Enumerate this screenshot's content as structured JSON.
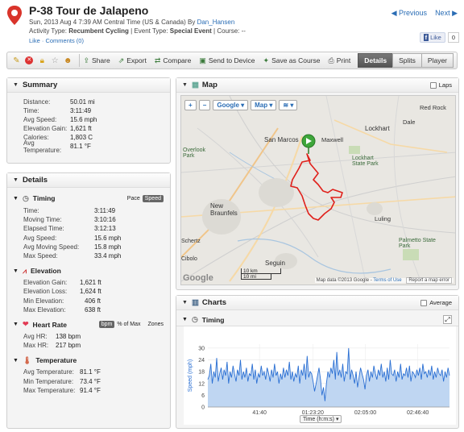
{
  "header": {
    "title": "P-38 Tour de Jalapeno",
    "date_line": "Sun, 2013 Aug 4 7:39 AM Central Time (US & Canada) By",
    "author": "Dan_Hansen",
    "activity_type_label": "Activity Type:",
    "activity_type": "Recumbent Cycling",
    "event_type_label": "| Event Type:",
    "event_type": "Special Event",
    "course_label": "| Course: --",
    "like_link": "Like",
    "comments_link": "· Comments (0)",
    "previous": "◀ Previous",
    "next": "Next ▶",
    "fb_like": "Like",
    "fb_count": "0"
  },
  "toolbar": {
    "share": "Share",
    "export": "Export",
    "compare": "Compare",
    "send": "Send to Device",
    "save_course": "Save as Course",
    "print": "Print",
    "tabs": [
      "Details",
      "Splits",
      "Player"
    ]
  },
  "summary": {
    "title": "Summary",
    "rows": [
      {
        "k": "Distance:",
        "v": "50.01 mi"
      },
      {
        "k": "Time:",
        "v": "3:11:49"
      },
      {
        "k": "Avg Speed:",
        "v": "15.6 mph"
      },
      {
        "k": "Elevation Gain:",
        "v": "1,621 ft"
      },
      {
        "k": "Calories:",
        "v": "1,803 C"
      },
      {
        "k": "Avg Temperature:",
        "v": "81.1 °F"
      }
    ]
  },
  "details": {
    "title": "Details",
    "timing": {
      "title": "Timing",
      "pace": "Pace",
      "speed": "Speed",
      "rows": [
        {
          "k": "Time:",
          "v": "3:11:49"
        },
        {
          "k": "Moving Time:",
          "v": "3:10:16"
        },
        {
          "k": "Elapsed Time:",
          "v": "3:12:13"
        },
        {
          "k": "Avg Speed:",
          "v": "15.6 mph"
        },
        {
          "k": "Avg Moving Speed:",
          "v": "15.8 mph"
        },
        {
          "k": "Max Speed:",
          "v": "33.4 mph"
        }
      ]
    },
    "elevation": {
      "title": "Elevation",
      "rows": [
        {
          "k": "Elevation Gain:",
          "v": "1,621 ft"
        },
        {
          "k": "Elevation Loss:",
          "v": "1,624 ft"
        },
        {
          "k": "Min Elevation:",
          "v": "406 ft"
        },
        {
          "k": "Max Elevation:",
          "v": "638 ft"
        }
      ]
    },
    "heart_rate": {
      "title": "Heart Rate",
      "bpm": "bpm",
      "pct_max": "% of Max",
      "zones": "Zones",
      "rows": [
        {
          "k": "Avg HR:",
          "v": "138 bpm"
        },
        {
          "k": "Max HR:",
          "v": "217 bpm"
        }
      ]
    },
    "temperature": {
      "title": "Temperature",
      "rows": [
        {
          "k": "Avg Temperature:",
          "v": "81.1 °F"
        },
        {
          "k": "Min Temperature:",
          "v": "73.4 °F"
        },
        {
          "k": "Max Temperature:",
          "v": "91.4 °F"
        }
      ]
    }
  },
  "map": {
    "title": "Map",
    "laps": "Laps",
    "zoom_in": "+",
    "zoom_out": "−",
    "provider": "Google ▾",
    "maptype": "Map ▾",
    "layers": "≋ ▾",
    "places": [
      "San Marcos",
      "Maxwell",
      "Lockhart",
      "Red Rock",
      "Dale",
      "Overlook Park",
      "Lockhart State Park",
      "New Braunfels",
      "Luling",
      "Seguin",
      "Palmetto State Park",
      "Schertz",
      "Cibolo"
    ],
    "scale_km": "10 km",
    "scale_mi": "10 mi",
    "google": "Google",
    "attribution": "Map data ©2013 Google -",
    "terms": "Terms of Use",
    "report": "Report a map error"
  },
  "charts": {
    "title": "Charts",
    "average": "Average",
    "timing_title": "Timing",
    "expand_icon": "expand-icon",
    "axis_select": "Time (h:m:s) ▾"
  },
  "chart_data": {
    "type": "area",
    "xlabel": "Time (h:m:s)",
    "ylabel": "Speed (mph)",
    "ylim": [
      0,
      32
    ],
    "yticks": [
      0,
      6,
      12,
      18,
      24,
      30
    ],
    "xticks": [
      {
        "t": 2460,
        "label": "41:40"
      },
      {
        "t": 5000,
        "label": "01:23:20"
      },
      {
        "t": 7500,
        "label": "02:05:00"
      },
      {
        "t": 10000,
        "label": "02:46:40"
      }
    ],
    "xlim": [
      0,
      11509
    ],
    "series": [
      {
        "values": [
          14,
          16,
          22,
          12,
          18,
          15,
          25,
          13,
          17,
          20,
          14,
          19,
          16,
          23,
          12,
          18,
          15,
          21,
          17,
          13,
          19,
          16,
          24,
          14,
          18,
          15,
          20,
          13,
          17,
          16,
          22,
          14,
          19,
          12,
          17,
          15,
          21,
          16,
          18,
          14,
          20,
          17,
          13,
          19,
          15,
          22,
          16,
          18,
          12,
          17,
          14,
          20,
          15,
          19,
          16,
          23,
          14,
          18,
          13,
          17,
          15,
          21,
          12,
          19,
          16,
          22,
          14,
          26,
          15,
          18,
          17,
          13,
          8,
          12,
          16,
          20,
          14,
          6,
          10,
          3,
          12,
          18,
          15,
          20,
          17,
          24,
          14,
          28,
          16,
          19,
          15,
          22,
          13,
          18,
          17,
          30,
          14,
          19,
          16,
          12,
          18,
          10,
          15,
          20,
          17,
          14,
          9,
          16,
          19,
          13,
          18,
          15,
          21,
          17,
          14,
          19,
          16,
          22,
          15,
          18,
          13,
          20,
          14,
          24,
          17,
          16,
          19,
          13,
          18,
          15,
          22,
          14,
          17,
          16,
          20,
          15,
          21,
          13,
          18,
          17,
          15,
          19,
          16,
          20,
          14,
          22,
          17,
          18,
          15,
          19,
          16,
          21,
          14,
          18,
          15,
          20,
          17,
          16,
          19,
          13,
          18,
          15,
          20,
          16
        ]
      }
    ]
  },
  "colors": {
    "route": "#e0201b",
    "series_line": "#2a6fd3",
    "series_fill": "#bfd6f2",
    "accent": "#2a6db5"
  }
}
